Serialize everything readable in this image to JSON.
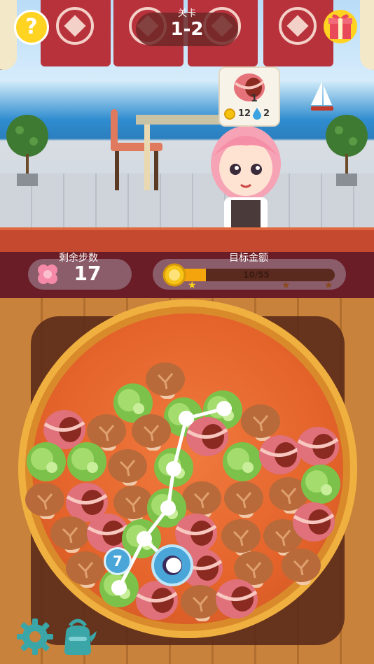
{
  "header": {
    "level_label": "关卡",
    "level_value": "1-2",
    "help_icon": "question-icon",
    "gift_icon": "gift-icon"
  },
  "customer": {
    "order_icon": "bacon-roll-icon",
    "order_count": "1",
    "coin_reward": "12",
    "water_reward": "2"
  },
  "status": {
    "moves_label": "剩余步数",
    "moves_value": "17",
    "goal_label": "目标金额",
    "goal_text": "10/55",
    "goal_progress": 0.18,
    "stars": 3
  },
  "board": {
    "chain_count": "7",
    "items": [
      "bacon-roll",
      "mushroom",
      "cabbage"
    ]
  },
  "toolbar": {
    "settings_icon": "gear-icon",
    "kettle_icon": "kettle-icon"
  },
  "colors": {
    "accent": "#f4a40c",
    "status_bg": "#6a1d26",
    "chain_line": "#ffffff",
    "badge": "#4aa6d8"
  }
}
